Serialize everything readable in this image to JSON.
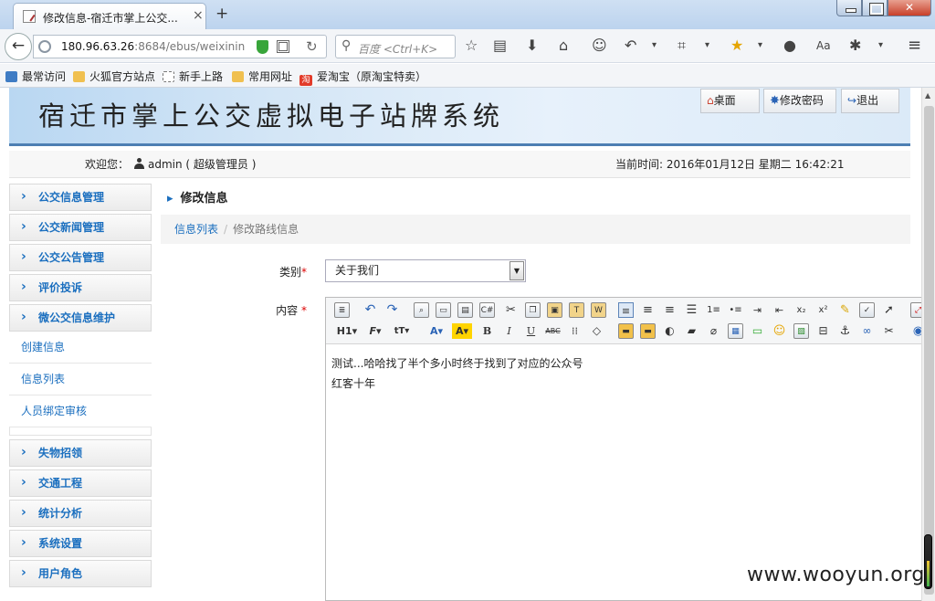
{
  "browser": {
    "tab_title": "修改信息-宿迁市掌上公交...",
    "tab_close": "×",
    "new_tab": "+",
    "close_label": "✕",
    "url_host": "180.96.63.26",
    "url_rest": ":8684/ebus/weixinin",
    "search_placeholder": "百度 <Ctrl+K>"
  },
  "bookmarks": [
    {
      "label": "最常访问",
      "color": "#3f7cc4"
    },
    {
      "label": "火狐官方站点",
      "color": "#f0c050"
    },
    {
      "label": "新手上路",
      "color": "#ffffff"
    },
    {
      "label": "常用网址",
      "color": "#f0c050"
    },
    {
      "label": "爱淘宝（原淘宝特卖）",
      "color": "#e23b2a",
      "icon_text": "淘"
    }
  ],
  "header": {
    "site_title": "宿迁市掌上公交虚拟电子站牌系统",
    "desktop": "桌面",
    "change_password": "修改密码",
    "logout": "退出"
  },
  "welcome": {
    "label": "欢迎您：",
    "user": "admin ( 超级管理员 )",
    "time_label": "当前时间:",
    "time_value": "2016年01月12日  星期二  16:42:21"
  },
  "sidebar": {
    "menus_top": [
      "公交信息管理",
      "公交新闻管理",
      "公交公告管理",
      "评价投诉",
      "微公交信息维护"
    ],
    "subitems": [
      "创建信息",
      "信息列表",
      "人员绑定审核"
    ],
    "menus_bottom": [
      "失物招领",
      "交通工程",
      "统计分析",
      "系统设置",
      "用户角色"
    ]
  },
  "main": {
    "section_title": "修改信息",
    "breadcrumb_link": "信息列表",
    "breadcrumb_sep": "/",
    "breadcrumb_current": "修改路线信息",
    "category_label": "类别",
    "content_label": "内容",
    "required_mark": "*",
    "category_value": "关于我们",
    "content_lines": [
      "测试...哈哈找了半个多小时终于找到了对应的公众号",
      "红客十年"
    ]
  },
  "watermark": "www.wooyun.org",
  "colors": {
    "link": "#1b6fbf",
    "header_line": "#4d7fb3",
    "required": "#dd0000"
  }
}
